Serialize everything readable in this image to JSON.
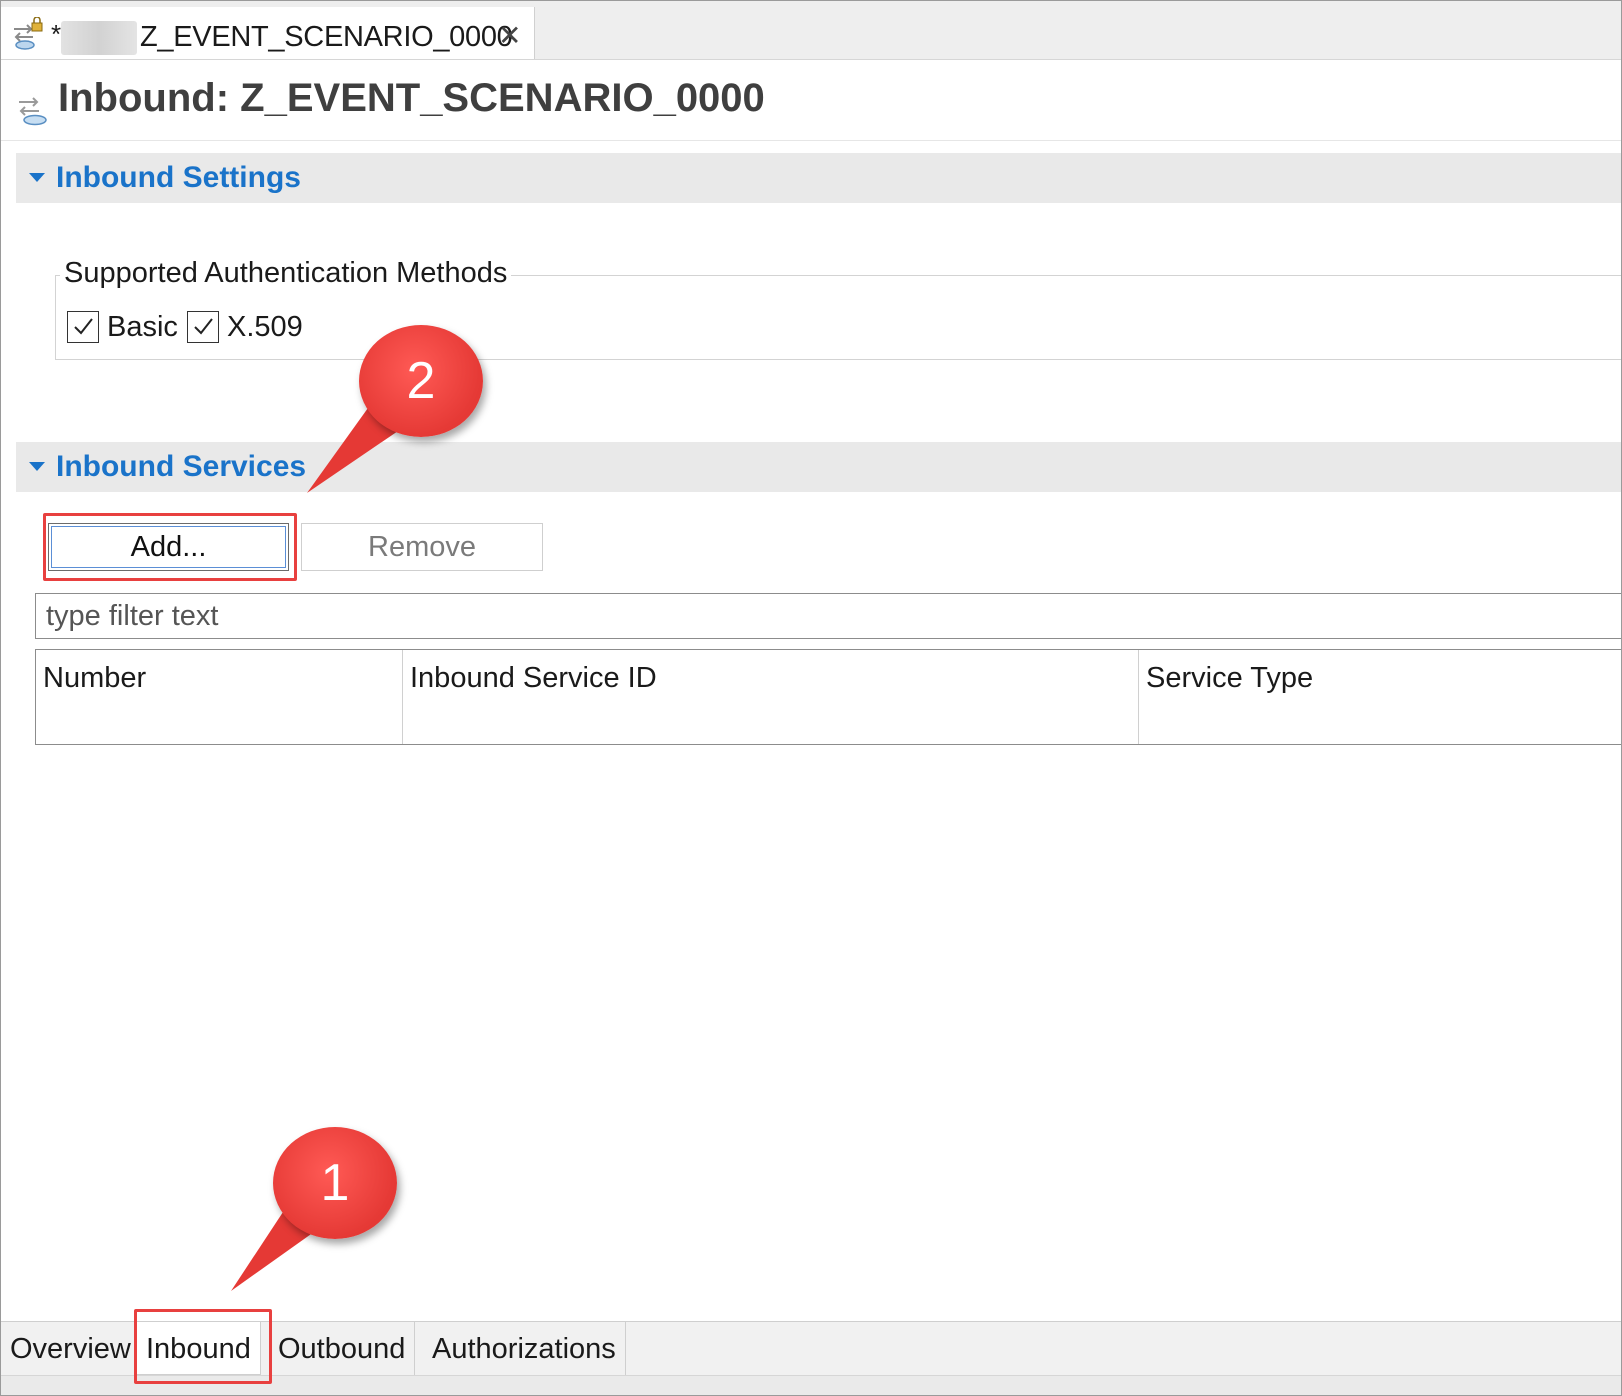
{
  "editor_tab": {
    "dirty_marker": "*",
    "title": "Z_EVENT_SCENARIO_0000",
    "close_glyph": "✕"
  },
  "form": {
    "title": "Inbound: Z_EVENT_SCENARIO_0000"
  },
  "inbound_settings": {
    "section_title": "Inbound Settings",
    "group_label": "Supported Authentication Methods",
    "methods": [
      {
        "label": "Basic",
        "checked": true
      },
      {
        "label": "X.509",
        "checked": true
      }
    ]
  },
  "inbound_services": {
    "section_title": "Inbound Services",
    "add_label": "Add...",
    "remove_label": "Remove",
    "filter_placeholder": "type filter text",
    "columns": [
      "Number",
      "Inbound Service ID",
      "Service Type"
    ]
  },
  "page_tabs": [
    {
      "label": "Overview",
      "active": false
    },
    {
      "label": "Inbound",
      "active": true
    },
    {
      "label": "Outbound",
      "active": false
    },
    {
      "label": "Authorizations",
      "active": false
    }
  ],
  "callouts": [
    {
      "number": "1"
    },
    {
      "number": "2"
    }
  ],
  "colors": {
    "accent": "#1a73c9",
    "callout": "#e53935",
    "highlight": "#e8403f"
  }
}
